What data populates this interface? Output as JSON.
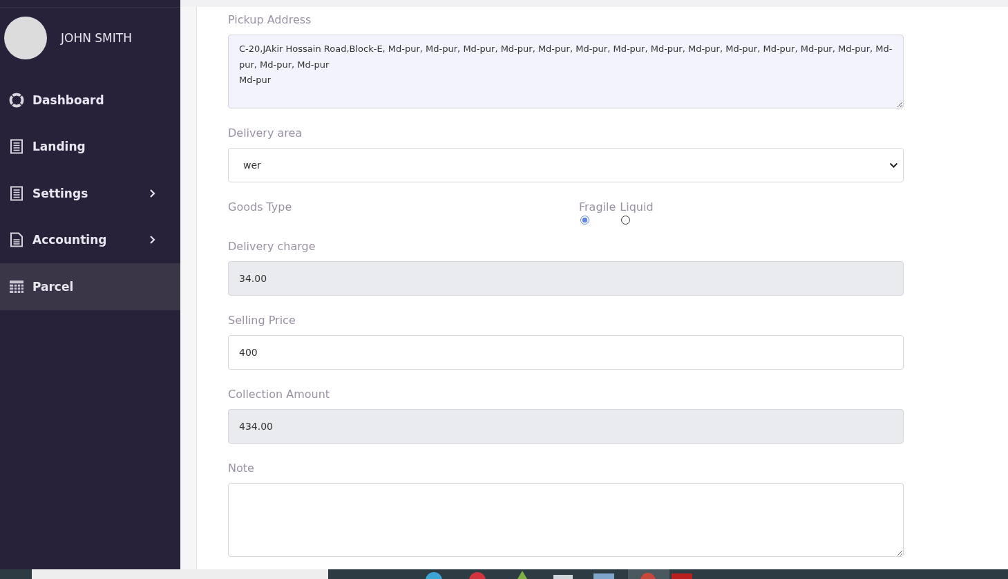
{
  "sidebar": {
    "user": {
      "name": "JOHN SMITH"
    },
    "items": [
      {
        "label": "Dashboard",
        "expandable": false,
        "selected": false
      },
      {
        "label": "Landing",
        "expandable": false,
        "selected": false
      },
      {
        "label": "Settings",
        "expandable": true,
        "selected": false
      },
      {
        "label": "Accounting",
        "expandable": true,
        "selected": false
      },
      {
        "label": "Parcel",
        "expandable": false,
        "selected": true
      }
    ]
  },
  "form": {
    "fields": [
      {
        "kind": "textarea",
        "label": "Pickup Address",
        "value": "C-20,JAkir Hossain Road,Block-E, Md-pur, Md-pur, Md-pur, Md-pur, Md-pur, Md-pur, Md-pur, Md-pur, Md-pur, Md-pur, Md-pur, Md-pur, Md-pur, Md-pur, Md-pur, Md-pur\nMd-pur"
      },
      {
        "kind": "select",
        "label": "Delivery area",
        "value": "wer"
      },
      {
        "kind": "radio",
        "label": "Goods Type",
        "options": [
          {
            "label": "Fragile",
            "selected": true
          },
          {
            "label": "Liquid",
            "selected": false
          }
        ]
      },
      {
        "kind": "readonly",
        "label": "Delivery charge",
        "value": "34.00"
      },
      {
        "kind": "input",
        "label": "Selling Price",
        "value": "400"
      },
      {
        "kind": "readonly",
        "label": "Collection Amount",
        "value": "434.00"
      },
      {
        "kind": "textarea",
        "label": "Note"
      }
    ]
  }
}
